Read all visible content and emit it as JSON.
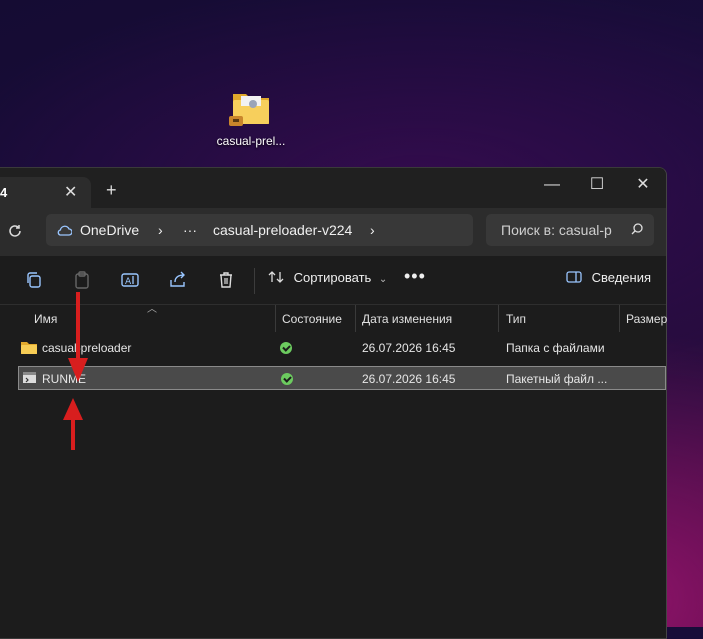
{
  "desktop": {
    "icon_label": "casual-prel..."
  },
  "window": {
    "tab": {
      "title": "4",
      "close": "✕"
    },
    "new_tab": "+",
    "controls": {
      "minimize": "—",
      "maximize": "☐",
      "close": "✕"
    },
    "address": {
      "segments": [
        "OneDrive",
        "›",
        "···",
        "casual-preloader-v224",
        "›"
      ]
    },
    "search": {
      "placeholder": "Поиск в: casual-p"
    },
    "toolbar": {
      "sort_label": "Сортировать",
      "more": "•••",
      "details_label": "Сведения"
    },
    "columns": [
      "Имя",
      "Состояние",
      "Дата изменения",
      "Тип",
      "Размер"
    ],
    "files": [
      {
        "name": "casual-preloader",
        "status": "synced",
        "date": "26.07.2026 16:45",
        "type": "Папка с файлами",
        "icon": "folder-icon",
        "selected": false
      },
      {
        "name": "RUNME",
        "status": "synced",
        "date": "26.07.2026 16:45",
        "type": "Пакетный файл ...",
        "icon": "batch-file-icon",
        "selected": true
      }
    ]
  },
  "colors": {
    "annotation_arrow": "#d81e1e",
    "folder": "#f4c54d",
    "status_ok": "#6ccb5f"
  }
}
